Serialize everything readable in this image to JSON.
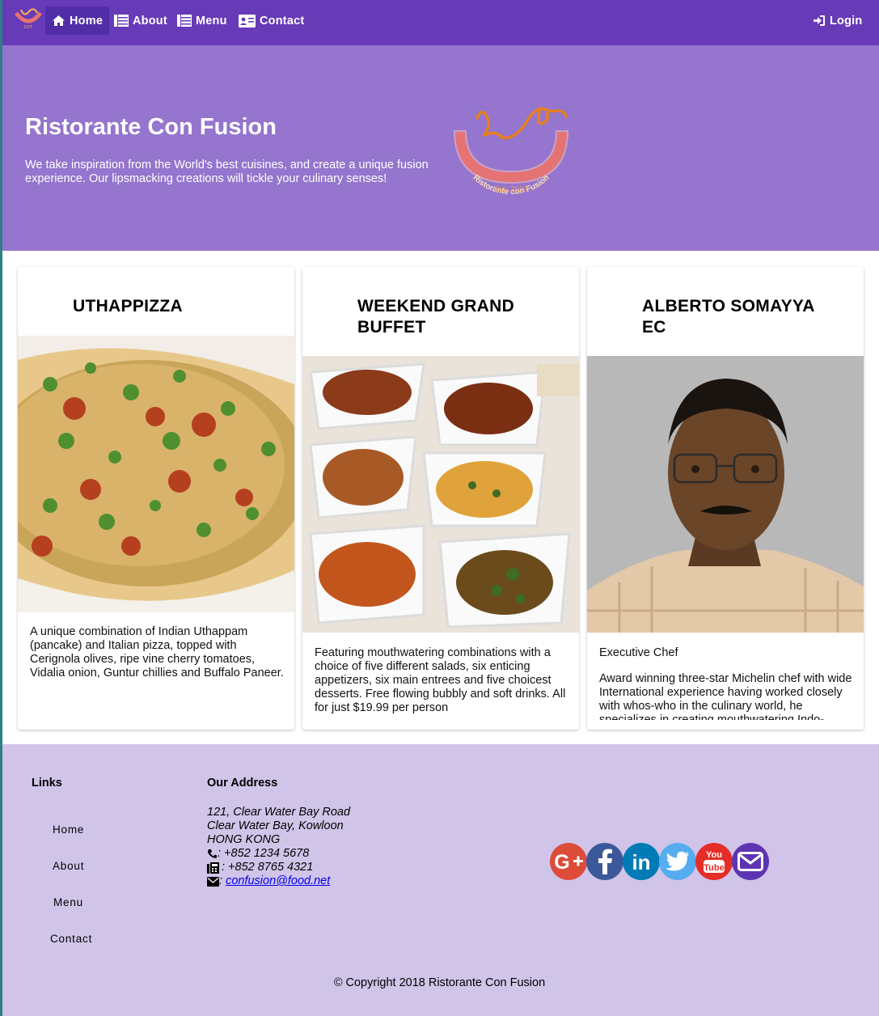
{
  "nav": {
    "items": [
      {
        "label": "Home"
      },
      {
        "label": "About"
      },
      {
        "label": "Menu"
      },
      {
        "label": "Contact"
      }
    ],
    "login_label": "Login"
  },
  "jumbotron": {
    "title": "Ristorante Con Fusion",
    "text": "We take inspiration from the World's best cuisines, and create a unique fusion experience. Our lipsmacking creations will tickle your culinary senses!",
    "logo_ring_text": "Ristorante con Fusion",
    "logo_est_text": "Est. 2013"
  },
  "cards": [
    {
      "title": "UTHAPPIZZA",
      "subtitle": "",
      "text": "A unique combination of Indian Uthappam (pancake) and Italian pizza, topped with Cerignola olives, ripe vine cherry tomatoes, Vidalia onion, Guntur chillies and Buffalo Paneer."
    },
    {
      "title": "WEEKEND GRAND BUFFET",
      "subtitle": "",
      "text": "Featuring mouthwatering combinations with a choice of five different salads, six enticing appetizers, six main entrees and five choicest desserts. Free flowing bubbly and soft drinks. All for just $19.99 per person"
    },
    {
      "title": "ALBERTO SOMAYYA EC",
      "subtitle": "Executive Chef",
      "text": "Award winning three-star Michelin chef with wide International experience having worked closely with whos-who in the culinary world, he specializes in creating mouthwatering Indo-"
    }
  ],
  "footer": {
    "links_heading": "Links",
    "links": [
      "Home",
      "About",
      "Menu",
      "Contact"
    ],
    "address_heading": "Our Address",
    "address_lines": [
      "121, Clear Water Bay Road",
      "Clear Water Bay, Kowloon",
      "HONG KONG"
    ],
    "phone": ": +852 1234 5678",
    "fax": ": +852 8765 4321",
    "email_prefix": ": ",
    "email": "confusion@food.net",
    "social": [
      {
        "name": "google-plus",
        "color": "#dd4b39"
      },
      {
        "name": "facebook",
        "color": "#3b5998"
      },
      {
        "name": "linkedin",
        "color": "#007bb6"
      },
      {
        "name": "twitter",
        "color": "#55acee"
      },
      {
        "name": "youtube",
        "color": "#e52d27"
      },
      {
        "name": "mail",
        "color": "#5e35b1"
      }
    ],
    "copyright": "© Copyright 2018 Ristorante Con Fusion"
  },
  "colors": {
    "navbar": "#673ab7",
    "nav_active": "#512da8",
    "jumbotron": "#9575cd",
    "footer": "#d1c4e9"
  }
}
